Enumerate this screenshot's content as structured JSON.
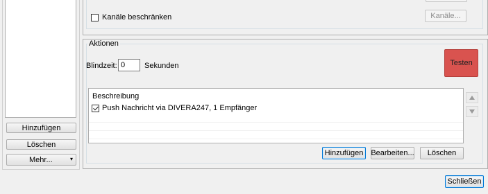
{
  "left_panel": {
    "add_label": "Hinzufügen",
    "delete_label": "Löschen",
    "more_label": "Mehr..."
  },
  "top_section": {
    "restrict_channels_label": "Kanäle beschränken",
    "restrict_channels_checked": false,
    "channels_button_label": "Kanäle..."
  },
  "actions": {
    "group_title": "Aktionen",
    "blindzeit_label": "Blindzeit:",
    "blindzeit_value": "0",
    "seconds_label": "Sekunden",
    "test_button_label": "Testen",
    "list_header": "Beschreibung",
    "items": [
      {
        "label": "Push Nachricht via DIVERA247, 1 Empfänger",
        "checked": true
      }
    ],
    "add_label": "Hinzufügen",
    "edit_label": "Bearbeiten...",
    "delete_label": "Löschen"
  },
  "footer": {
    "close_label": "Schließen"
  },
  "colors": {
    "test_button_bg": "#d9534f",
    "focus_border": "#0078d7",
    "window_bg": "#f0f0f0"
  }
}
